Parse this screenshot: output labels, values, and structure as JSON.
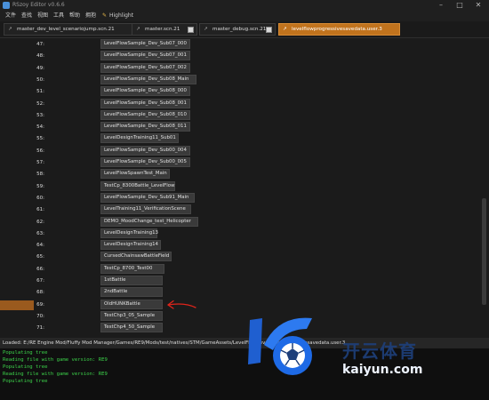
{
  "window": {
    "title": "RSzoy Editor v0.6.6",
    "controls": [
      "–",
      "□",
      "✕"
    ]
  },
  "menu": [
    "文件",
    "查找",
    "视图",
    "工具",
    "帮助",
    "拥抱",
    "Highlight"
  ],
  "tabs": [
    {
      "label": "master_dev_level_scenariojump.scn.21",
      "active": false
    },
    {
      "label": "master.scn.21",
      "active": false
    },
    {
      "label": "master_debug.scn.21",
      "active": false
    },
    {
      "label": "levelflowprogressivesavedata.user.3",
      "active": true
    }
  ],
  "tree": {
    "rows": [
      {
        "index": "47:",
        "label": "LevelFlowSample_Dev_Sub07_000"
      },
      {
        "index": "48:",
        "label": "LevelFlowSample_Dev_Sub07_001"
      },
      {
        "index": "49:",
        "label": "LevelFlowSample_Dev_Sub07_002"
      },
      {
        "index": "50:",
        "label": "LevelFlowSample_Dev_Sub08_Main"
      },
      {
        "index": "51:",
        "label": "LevelFlowSample_Dev_Sub08_000"
      },
      {
        "index": "52:",
        "label": "LevelFlowSample_Dev_Sub08_001"
      },
      {
        "index": "53:",
        "label": "LevelFlowSample_Dev_Sub08_010"
      },
      {
        "index": "54:",
        "label": "LevelFlowSample_Dev_Sub08_011"
      },
      {
        "index": "55:",
        "label": "LevelDesignTraining11_Sub01"
      },
      {
        "index": "56:",
        "label": "LevelFlowSample_Dev_Sub00_004"
      },
      {
        "index": "57:",
        "label": "LevelFlowSample_Dev_Sub00_005"
      },
      {
        "index": "58:",
        "label": "LevelFlowSpawnTest_Main"
      },
      {
        "index": "59:",
        "label": "TestCp_8300Battle_LevelFlow"
      },
      {
        "index": "60:",
        "label": "LevelFlowSample_Dev_Sub91_Main"
      },
      {
        "index": "61:",
        "label": "LevelTraining11_VerificationScene"
      },
      {
        "index": "62:",
        "label": "DEMO_MoodChange_test_Helicopter"
      },
      {
        "index": "63:",
        "label": "LevelDesignTraining13"
      },
      {
        "index": "64:",
        "label": "LevelDesignTraining14"
      },
      {
        "index": "65:",
        "label": "CursedChainsawBattleField"
      },
      {
        "index": "66:",
        "label": "TestCp_8700_Test00"
      },
      {
        "index": "67:",
        "label": "1stBattle"
      },
      {
        "index": "68:",
        "label": "2ndBattle"
      },
      {
        "index": "69:",
        "label": "OldHUNKBattle",
        "highlighted": true
      },
      {
        "index": "70:",
        "label": "TestChp3_05_Sample"
      },
      {
        "index": "71:",
        "label": "TestChp4_50_Sample"
      }
    ]
  },
  "status": "Loaded: E:/RE Engine Mod/Fluffy Mod Manager/Games/RE9/Mods/test/natives/STM/GameAssets/LevelFlow/levelflowprogressivesavedata.user.3",
  "log": [
    "Populating tree",
    "Reading file with game version: RE9",
    "Populating tree",
    "Reading file with game version: RE9",
    "Populating tree"
  ],
  "watermark": {
    "text": "开云体育",
    "url": "kaiyun.com"
  },
  "colors": {
    "accent": "#c1731d",
    "log_text": "#3cd14a",
    "arrow": "#e0241b"
  }
}
